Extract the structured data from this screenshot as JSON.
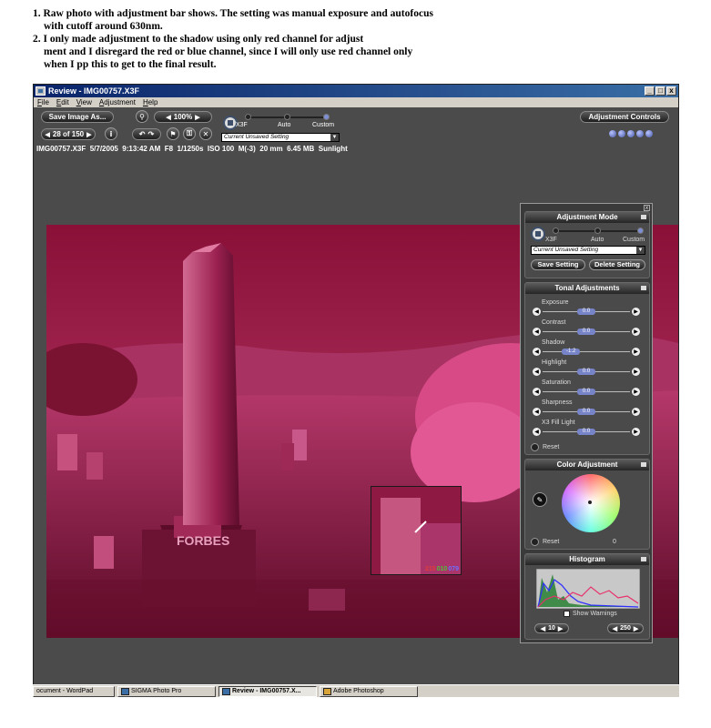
{
  "notes": {
    "line1": "1. Raw photo with adjustment bar shows. The setting was manual exposure and autofocus",
    "line1b": "with cutoff around 630nm.",
    "line2": "2. I only made adjustment to the shadow using only red channel for adjust",
    "line2b": "ment and I disregard the red or blue channel, since I will only use red channel only",
    "line2c": "when I pp this to get to the final result."
  },
  "window": {
    "title": "Review - IMG00757.X3F",
    "menu": [
      "File",
      "Edit",
      "View",
      "Adjustment",
      "Help"
    ],
    "controls": {
      "minimize": "_",
      "maximize": "□",
      "close": "x"
    }
  },
  "toolbar": {
    "save_image_label": "Save Image As...",
    "zoom_value": "100%",
    "counter": "28 of 150",
    "mode_labels": {
      "x3f": "X3F",
      "auto": "Auto",
      "custom": "Custom"
    },
    "setting_select": "Current Unsaved Setting",
    "adjustment_controls_label": "Adjustment Controls"
  },
  "info_line": {
    "filename": "IMG00757.X3F",
    "date": "5/7/2005",
    "time": "9:13:42 AM",
    "aperture": "F8",
    "shutter": "1/1250s",
    "iso": "ISO 100",
    "mode": "M(-3)",
    "focal": "20 mm",
    "size": "6.45 MB",
    "white_balance": "Sunlight"
  },
  "photo": {
    "stone_text": "FORBES",
    "loupe_values": {
      "r": "215",
      "g": "010",
      "b": "079"
    },
    "colors": {
      "r": "#e23c3c",
      "g": "#4fbf3a",
      "b": "#6d6dff"
    }
  },
  "adjustment_panel": {
    "mode_title": "Adjustment Mode",
    "mode_labels": {
      "x3f": "X3F",
      "auto": "Auto",
      "custom": "Custom"
    },
    "setting_select": "Current Unsaved Setting",
    "save_setting_label": "Save Setting",
    "delete_setting_label": "Delete Setting",
    "tonal_title": "Tonal Adjustments",
    "sliders": [
      {
        "label": "Exposure",
        "value": "0.0"
      },
      {
        "label": "Contrast",
        "value": "0.0"
      },
      {
        "label": "Shadow",
        "value": "-1.2"
      },
      {
        "label": "Highlight",
        "value": "0.0"
      },
      {
        "label": "Saturation",
        "value": "0.0"
      },
      {
        "label": "Sharpness",
        "value": "0.0"
      },
      {
        "label": "X3 Fill Light",
        "value": "0.0"
      }
    ],
    "reset_label": "Reset",
    "color_title": "Color Adjustment",
    "color_reset_label": "Reset",
    "color_value": "0",
    "histogram_title": "Histogram",
    "show_warnings_label": "Show Warnings",
    "hist_low": "10",
    "hist_high": "250"
  },
  "taskbar": {
    "items": [
      "ocument - WordPad",
      "SIGMA Photo Pro",
      "Review - IMG00757.X...",
      "Adobe Photoshop"
    ]
  }
}
